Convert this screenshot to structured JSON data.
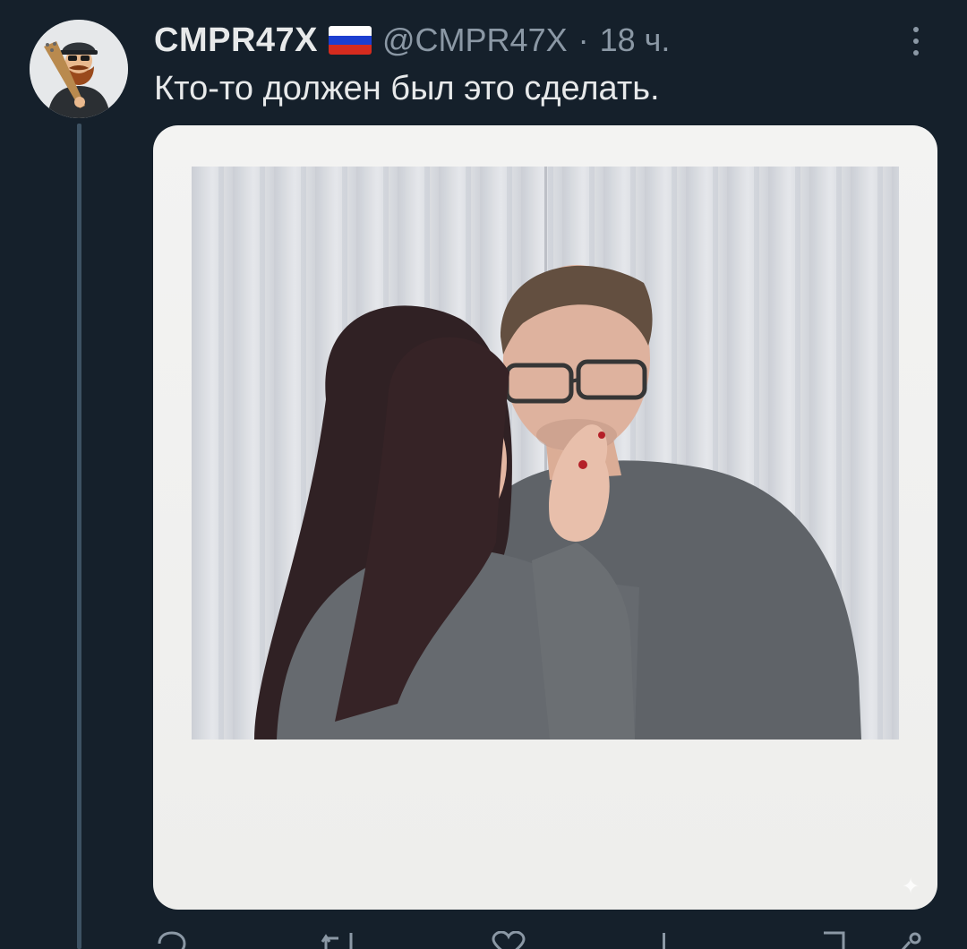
{
  "tweet": {
    "display_name": "CMPR47X",
    "handle": "@CMPR47X",
    "separator": "·",
    "time": "18 ч.",
    "text": "Кто-то должен был это сделать."
  },
  "author_flag": {
    "name": "russia-flag",
    "colors": [
      "#ffffff",
      "#1c3fd0",
      "#d52b1e"
    ]
  },
  "icons": {
    "more": "more-vertical-icon",
    "reply": "reply-icon",
    "retweet": "retweet-icon",
    "like": "heart-icon",
    "views": "views-icon",
    "bookmark": "bookmark-icon",
    "share": "share-icon"
  },
  "colors": {
    "background": "#15202b",
    "text_primary": "#e7e9ea",
    "text_secondary": "#8b98a5",
    "thread_line": "#3d5263"
  }
}
